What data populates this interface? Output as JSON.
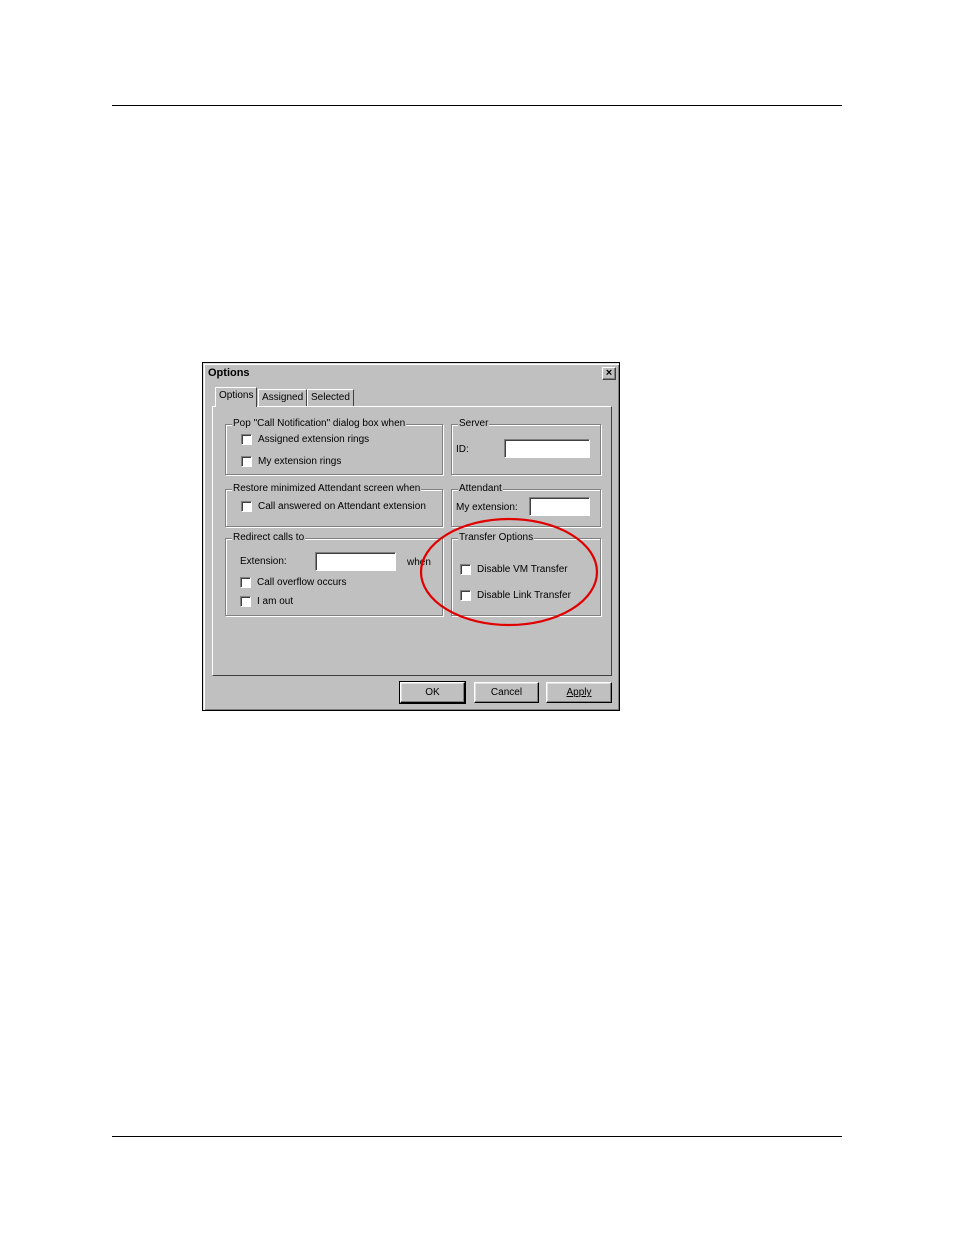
{
  "dialog": {
    "title": "Options",
    "close_icon": "close-icon"
  },
  "tabs": [
    {
      "label": "Options",
      "active": true
    },
    {
      "label": "Assigned",
      "active": false
    },
    {
      "label": "Selected",
      "active": false
    }
  ],
  "popup_group": {
    "legend": "Pop \"Call Notification\" dialog box when",
    "opt1": "Assigned extension rings",
    "opt2": "My extension rings"
  },
  "server_group": {
    "legend": "Server",
    "id_label": "ID:",
    "id_value": ""
  },
  "restore_group": {
    "legend": "Restore minimized Attendant screen when",
    "opt1": "Call answered on Attendant extension"
  },
  "attendant_group": {
    "legend": "Attendant",
    "ext_label": "My extension:",
    "ext_value": ""
  },
  "redirect_group": {
    "legend": "Redirect calls to",
    "ext_label": "Extension:",
    "ext_value": "",
    "when_label": "when",
    "opt1": "Call overflow occurs",
    "opt2": "I am out"
  },
  "transfer_group": {
    "legend": "Transfer Options",
    "opt1": "Disable VM Transfer",
    "opt2": "Disable Link Transfer"
  },
  "buttons": {
    "ok": "OK",
    "cancel": "Cancel",
    "apply": "Apply"
  },
  "colors": {
    "highlight_ellipse": "#e00000",
    "dialog_face": "#c0c0c0"
  }
}
